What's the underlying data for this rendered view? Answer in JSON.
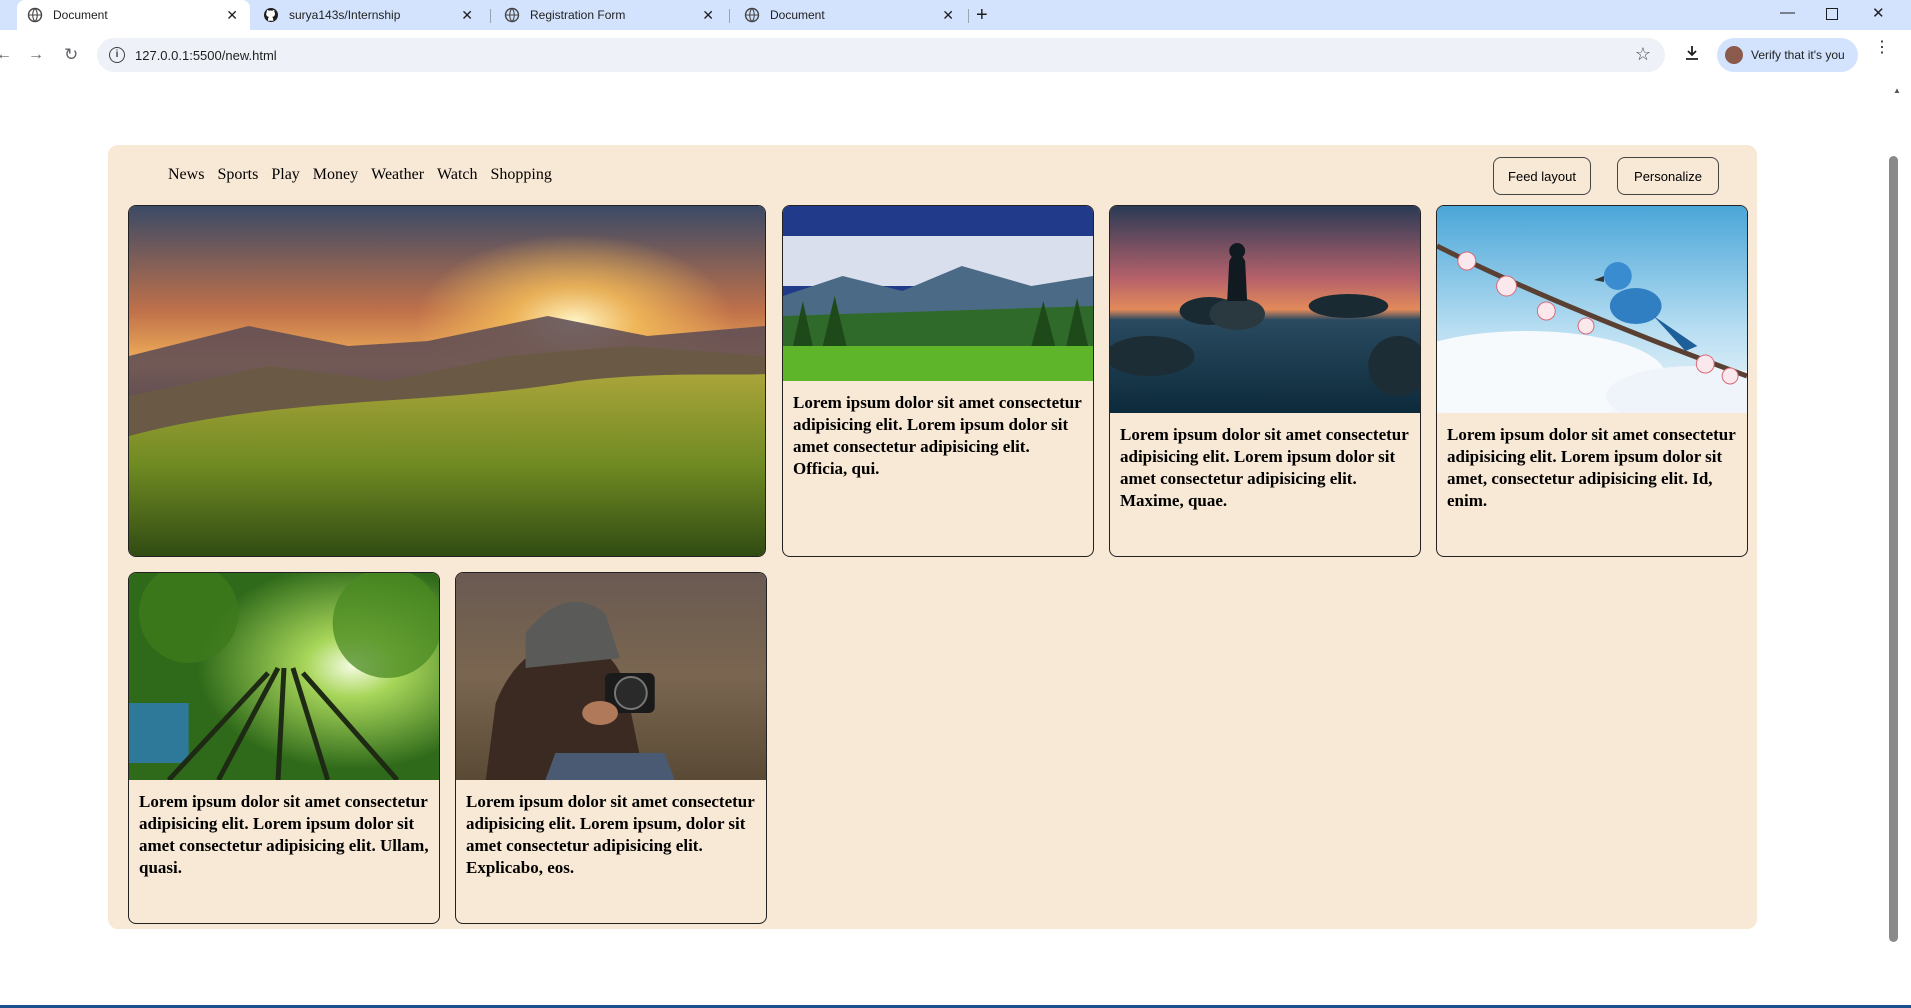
{
  "browser": {
    "tabs": [
      {
        "title": "Document",
        "active": true
      },
      {
        "title": "surya143s/Internship",
        "active": false
      },
      {
        "title": "Registration Form",
        "active": false
      },
      {
        "title": "Document",
        "active": false
      }
    ],
    "url": "127.0.0.1:5500/new.html",
    "profile_label": "Verify that it's you"
  },
  "nav": {
    "items": [
      "News",
      "Sports",
      "Play",
      "Money",
      "Weather",
      "Watch",
      "Shopping"
    ]
  },
  "actions": {
    "feed_layout": "Feed layout",
    "personalize": "Personalize"
  },
  "cards": [
    {
      "image": "sunset-mountain-meadow",
      "text": ""
    },
    {
      "image": "alpine-valley-landscape",
      "text": "Lorem ipsum dolor sit amet consectetur adipisicing elit. Lorem ipsum dolor sit amet consectetur adipisicing elit. Officia, qui."
    },
    {
      "image": "person-on-rock-lake",
      "text": "Lorem ipsum dolor sit amet consectetur adipisicing elit. Lorem ipsum dolor sit amet consectetur adipisicing elit. Maxime, quae."
    },
    {
      "image": "bluebird-on-blossom",
      "text": "Lorem ipsum dolor sit amet consectetur adipisicing elit. Lorem ipsum dolor sit amet, consectetur adipisicing elit. Id, enim."
    },
    {
      "image": "forest-canopy",
      "text": "Lorem ipsum dolor sit amet consectetur adipisicing elit. Lorem ipsum dolor sit amet consectetur adipisicing elit. Ullam, quasi."
    },
    {
      "image": "photographer-with-camera",
      "text": "Lorem ipsum dolor sit amet consectetur adipisicing elit. Lorem ipsum, dolor sit amet consectetur adipisicing elit. Explicabo, eos."
    }
  ],
  "colors": {
    "panel_background": "#f8e8d6",
    "tabstrip": "#d3e3fd"
  }
}
